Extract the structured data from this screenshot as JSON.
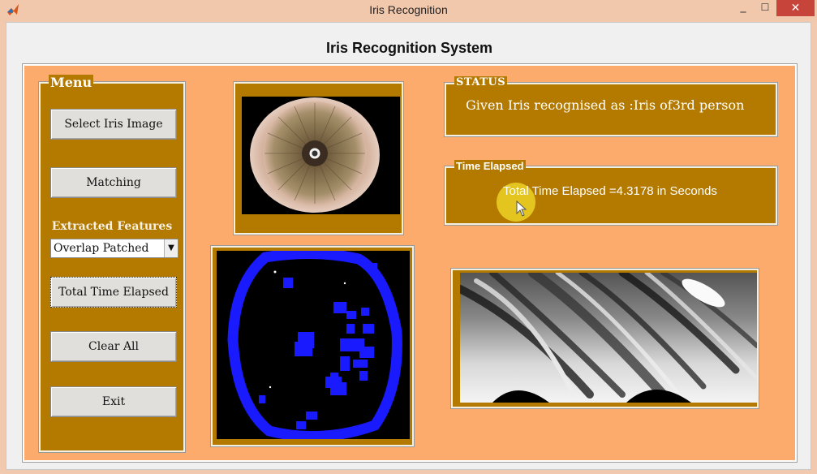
{
  "window": {
    "title": "Iris Recognition",
    "min_glyph": "_",
    "max_glyph": "☐",
    "close_glyph": "✕"
  },
  "system_title": "Iris Recognition System",
  "menu": {
    "legend": "Menu",
    "buttons": {
      "select_iris": "Select Iris Image",
      "matching": "Matching",
      "total_time": "Total Time Elapsed",
      "clear_all": "Clear All",
      "exit": "Exit"
    },
    "features_label": "Extracted Features",
    "features_selected": "Overlap Patched"
  },
  "status": {
    "legend": "STATUS",
    "text": "Given Iris recognised as :Iris of3rd person"
  },
  "elapsed": {
    "legend": "Time Elapsed",
    "text": "Total Time Elapsed =4.3178 in Seconds"
  },
  "icons": {
    "app": "matlab-icon",
    "dropdown": "chevron-down-icon",
    "cursor": "mouse-pointer-icon"
  },
  "colors": {
    "panel_bg": "#fdaa6d",
    "group_bg": "#b47a00",
    "mask_blue": "#1a1aff"
  }
}
